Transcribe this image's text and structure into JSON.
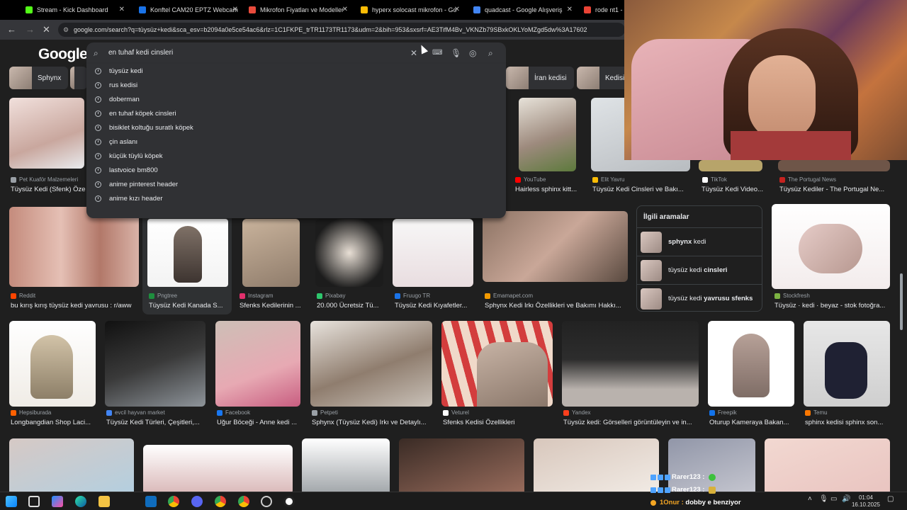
{
  "tabs": [
    {
      "label": "Stream - Kick Dashboard",
      "color": "#53fc18"
    },
    {
      "label": "Konftel CAM20 EPTZ Webcam",
      "color": "#1a73e8"
    },
    {
      "label": "Mikrofon Fiyatları ve Modeller",
      "color": "#e94b3c"
    },
    {
      "label": "hyperx solocast mikrofon - Go",
      "color": "#fbbc05"
    },
    {
      "label": "quadcast - Google Alışveriş",
      "color": "#4285f4"
    },
    {
      "label": "rode nt1 - G",
      "color": "#ea4335"
    }
  ],
  "address": {
    "url": "google.com/search?q=tüysüz+kedi&sca_esv=b2094a0e5ce54ac6&rlz=1C1FKPE_trTR1173TR1173&udm=2&bih=953&sxsrf=AE3TifM4Bv_VKNZb79SBxkOKLYoMZgd5dw%3A17602",
    "back_icon": "arrow-left-icon",
    "forward_icon": "arrow-right-icon",
    "reload_icon": "close-loading-icon"
  },
  "google": {
    "logo": "Google",
    "query": "en tuhaf kedi cinsleri",
    "suggestions": [
      "tüysüz kedi",
      "rus kedisi",
      "doberman",
      "en tuhaf köpek cinsleri",
      "bisiklet koltuğu suratlı köpek",
      "çin aslanı",
      "küçük tüylü köpek",
      "lastvoice bm800",
      "anime pinterest header",
      "anime kızı header"
    ]
  },
  "chips": [
    {
      "label": "Sphynx"
    },
    {
      "label": "İran kedisi"
    },
    {
      "label": "Kedisi"
    }
  ],
  "results_row1": [
    {
      "source": "Pet Kuaför Malzemeleri",
      "caption": "Tüysüz Kedi (Sfenk) Öze",
      "src_color": "#9aa0a6"
    },
    {
      "source": "YouTube",
      "caption": "Hairless sphinx kitt...",
      "src_color": "#ff0000"
    },
    {
      "source": "Elit Yavru",
      "caption": "Tüysüz Kedi Cinsleri ve Bakı...",
      "src_color": "#fbbc05"
    },
    {
      "source": "TikTok",
      "caption": "Tüysüz Kedi Video...",
      "src_color": "#ffffff"
    },
    {
      "source": "The Portugal News",
      "caption": "Tüysüz Kediler - The Portugal Ne...",
      "src_color": "#c5221f"
    }
  ],
  "results_row2": [
    {
      "source": "Reddit",
      "caption": "bu kırış kırış tüysüz kedi yavrusu : r/aww",
      "src_color": "#ff4500"
    },
    {
      "source": "Pngtree",
      "caption": "Tüysüz Kedi Kanada S...",
      "src_color": "#1e8e3e"
    },
    {
      "source": "Instagram",
      "caption": "Sfenks Kedilerinin ...",
      "src_color": "#e1306c"
    },
    {
      "source": "Pixabay",
      "caption": "20.000 Ücretsiz Tü...",
      "src_color": "#2ec66d"
    },
    {
      "source": "Fruugo TR",
      "caption": "Tüysüz Kedi Kıyafetler...",
      "src_color": "#1a73e8"
    },
    {
      "source": "Emamapet.com",
      "caption": "Sphynx Kedi Irkı Özellikleri ve Bakımı Hakkı...",
      "src_color": "#f29900"
    },
    {
      "source": "Stockfresh",
      "caption": "Tüysüz · kedi · beyaz - stok fotoğra...",
      "src_color": "#7cb342"
    }
  ],
  "related": {
    "title": "İlgili aramalar",
    "items": [
      {
        "bold": "sphynx",
        "rest": " kedi"
      },
      {
        "bold": "",
        "plain": "tüysüz kedi ",
        "rest": "cinsleri"
      },
      {
        "bold": "",
        "plain": "tüysüz kedi ",
        "rest": "yavrusu sfenks"
      }
    ]
  },
  "results_row3": [
    {
      "source": "Hepsiburada",
      "caption": "Longbangdian Shop Laci...",
      "src_color": "#ff6000"
    },
    {
      "source": "evcil hayvan market",
      "caption": "Tüysüz Kedi Türleri, Çeşitleri,...",
      "src_color": "#4285f4"
    },
    {
      "source": "Facebook",
      "caption": "Uğur Böceği - Anne kedi ...",
      "src_color": "#1877f2"
    },
    {
      "source": "Petpeti",
      "caption": "Sphynx (Tüysüz Kedi) Irkı ve Detaylı...",
      "src_color": "#9aa0a6"
    },
    {
      "source": "Veturel",
      "caption": "Sfenks Kedisi Özellikleri",
      "src_color": "#ffffff"
    },
    {
      "source": "Yandex",
      "caption": "Tüysüz kedi: Görselleri görüntüleyin ve in...",
      "src_color": "#fc3f1d"
    },
    {
      "source": "Freepik",
      "caption": "Oturup Kameraya Bakan...",
      "src_color": "#1273eb"
    },
    {
      "source": "Temu",
      "caption": "sphinx kedisi sphinx son...",
      "src_color": "#fb7701"
    }
  ],
  "chat": [
    {
      "user": "Rarer123 :",
      "emote": "green"
    },
    {
      "user": "Rarer123 :",
      "emote": "yellow"
    },
    {
      "user": "1Onur :",
      "message": "dobby e benziyor"
    }
  ],
  "taskbar": {
    "time": "01:04",
    "date": "16.10.2025",
    "icons": [
      "windows-icon",
      "task-view-icon",
      "copilot-icon",
      "edge-icon",
      "explorer-icon",
      "outlook-icon",
      "chrome-icon",
      "discord-icon",
      "chrome-icon",
      "chrome-icon",
      "obs-icon",
      "steam-icon"
    ]
  }
}
